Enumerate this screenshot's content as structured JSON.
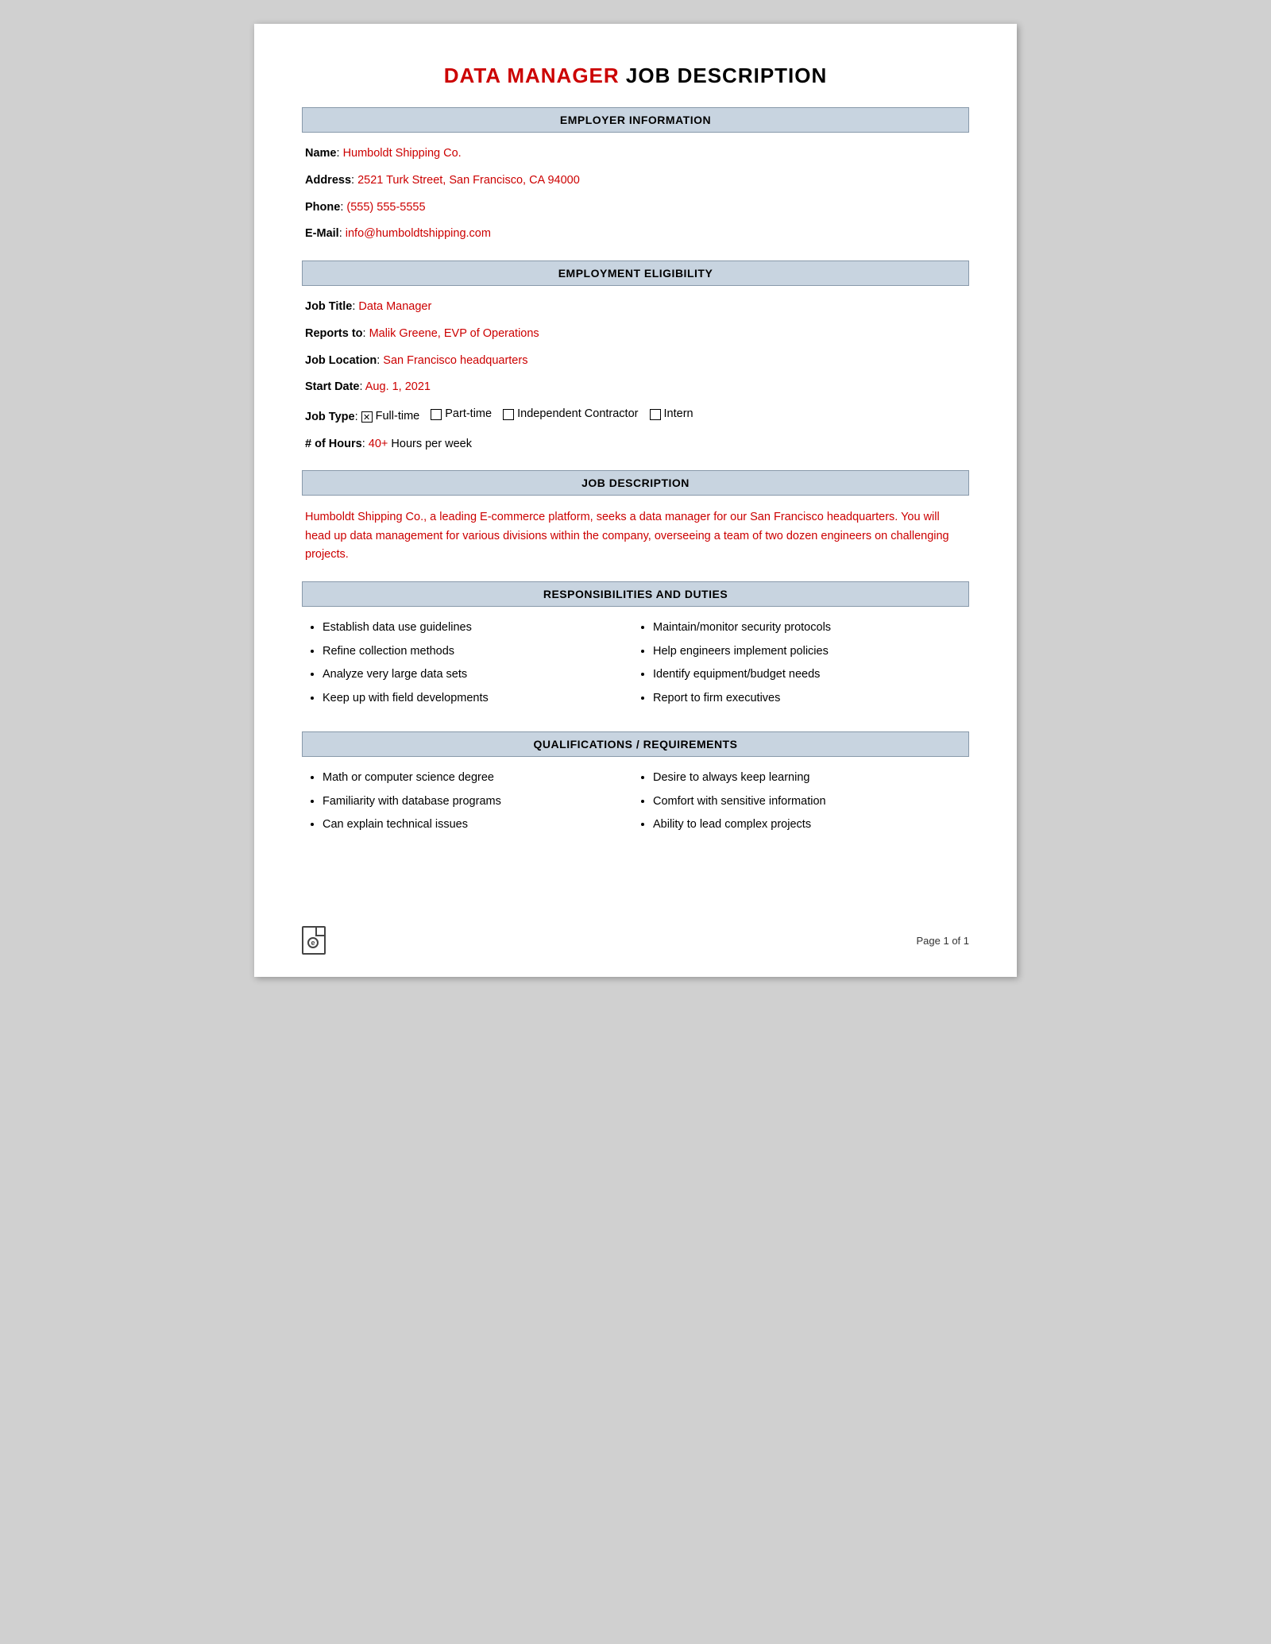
{
  "page": {
    "title_red": "DATA MANAGER",
    "title_black": " JOB DESCRIPTION"
  },
  "employer_section": {
    "header": "EMPLOYER INFORMATION",
    "name_label": "Name",
    "name_value": "Humboldt Shipping Co.",
    "address_label": "Address",
    "address_value": "2521 Turk Street, San Francisco, CA 94000",
    "phone_label": "Phone",
    "phone_value": "(555) 555-5555",
    "email_label": "E-Mail",
    "email_value": "info@humboldtshipping.com"
  },
  "eligibility_section": {
    "header": "EMPLOYMENT ELIGIBILITY",
    "job_title_label": "Job Title",
    "job_title_value": "Data Manager",
    "reports_to_label": "Reports to",
    "reports_to_value": "Malik Greene, EVP of Operations",
    "location_label": "Job Location",
    "location_value": "San Francisco headquarters",
    "start_date_label": "Start Date",
    "start_date_value": "Aug. 1, 2021",
    "job_type_label": "Job Type",
    "job_type_fulltime": "Full-time",
    "job_type_parttime": "Part-time",
    "job_type_contractor": "Independent Contractor",
    "job_type_intern": "Intern",
    "hours_label": "# of Hours",
    "hours_value": "40+",
    "hours_suffix": " Hours per week"
  },
  "job_description_section": {
    "header": "JOB DESCRIPTION",
    "description": "Humboldt Shipping Co., a leading E-commerce platform, seeks a data manager for our San Francisco headquarters. You will head up data management for various divisions within the company, overseeing a team of two dozen engineers on challenging projects."
  },
  "responsibilities_section": {
    "header": "RESPONSIBILITIES AND DUTIES",
    "col1": [
      "Establish data use guidelines",
      "Refine collection methods",
      "Analyze very large data sets",
      "Keep up with field developments"
    ],
    "col2": [
      "Maintain/monitor security protocols",
      "Help engineers implement policies",
      "Identify equipment/budget needs",
      "Report to firm executives"
    ]
  },
  "qualifications_section": {
    "header": "QUALIFICATIONS / REQUIREMENTS",
    "col1": [
      "Math or computer science degree",
      "Familiarity with database programs",
      "Can explain technical issues"
    ],
    "col2": [
      "Desire to always keep learning",
      "Comfort with sensitive information",
      "Ability to lead complex projects"
    ]
  },
  "footer": {
    "page_label": "Page 1 of 1"
  }
}
